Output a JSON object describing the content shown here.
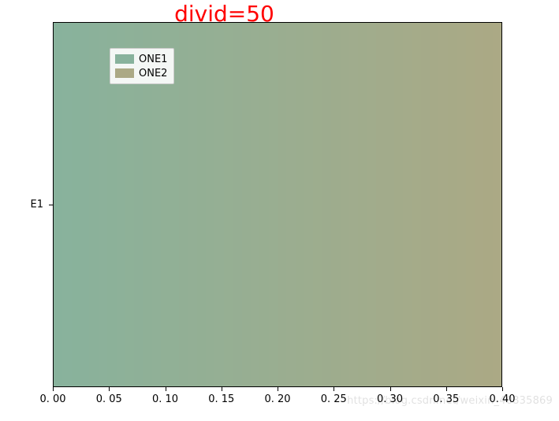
{
  "chart_data": {
    "type": "bar",
    "title": "divid=50",
    "title_color": "#ff0000",
    "categories": [
      "E1"
    ],
    "series": [
      {
        "name": "ONE1",
        "values": [
          0.4
        ],
        "color": "#88b29c"
      },
      {
        "name": "ONE2",
        "values": [
          0.4
        ],
        "color": "#aba985"
      }
    ],
    "gradient_segments": 50,
    "xlabel": "",
    "ylabel": "",
    "xlim": [
      0.0,
      0.4
    ],
    "xticks": [
      0.0,
      0.05,
      0.1,
      0.15,
      0.2,
      0.25,
      0.3,
      0.35,
      0.4
    ],
    "xtick_labels": [
      "0. 00",
      "0. 05",
      "0. 10",
      "0. 15",
      "0. 20",
      "0. 25",
      "0. 30",
      "0. 35",
      "0. 40"
    ],
    "yticks": [
      "E1"
    ]
  },
  "legend": {
    "items": [
      {
        "label": "ONE1",
        "color": "#88b29c"
      },
      {
        "label": "ONE2",
        "color": "#aba985"
      }
    ]
  },
  "watermark": "https://blog.csdn.net/weixin_40835869"
}
